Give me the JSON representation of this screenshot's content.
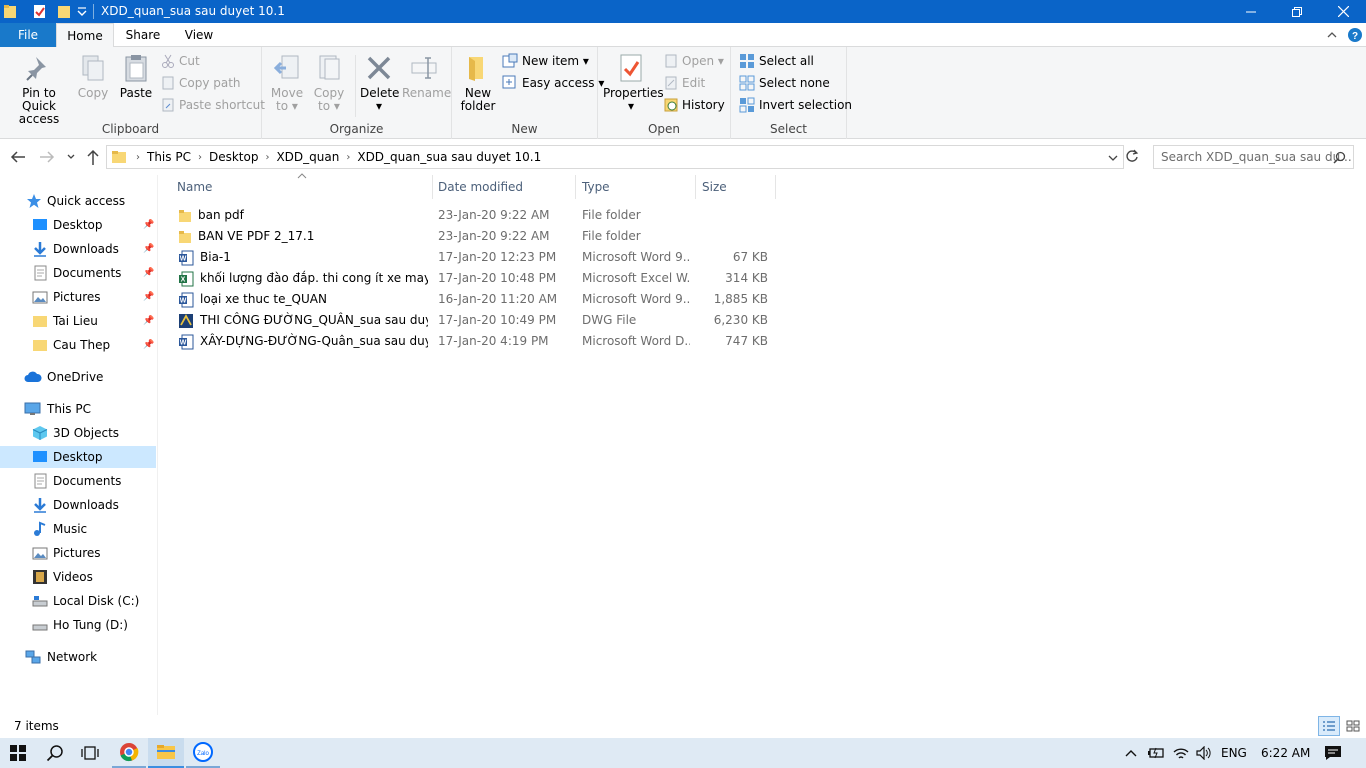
{
  "window": {
    "title": "XDD_quan_sua sau duyet 10.1"
  },
  "ribbon_tabs": {
    "file": "File",
    "home": "Home",
    "share": "Share",
    "view": "View"
  },
  "ribbon": {
    "clipboard": {
      "label": "Clipboard",
      "pin_line1": "Pin to Quick",
      "pin_line2": "access",
      "copy": "Copy",
      "paste": "Paste",
      "cut": "Cut",
      "copy_path": "Copy path",
      "paste_shortcut": "Paste shortcut"
    },
    "organize": {
      "label": "Organize",
      "move_line1": "Move",
      "move_line2": "to",
      "copy_line1": "Copy",
      "copy_line2": "to",
      "delete": "Delete",
      "rename": "Rename"
    },
    "new": {
      "label": "New",
      "new_folder_line1": "New",
      "new_folder_line2": "folder",
      "new_item": "New item",
      "easy_access": "Easy access"
    },
    "open": {
      "label": "Open",
      "properties": "Properties",
      "open": "Open",
      "edit": "Edit",
      "history": "History"
    },
    "select": {
      "label": "Select",
      "select_all": "Select all",
      "select_none": "Select none",
      "invert_selection": "Invert selection"
    }
  },
  "address": {
    "crumbs": [
      "This PC",
      "Desktop",
      "XDD_quan",
      "XDD_quan_sua sau duyet 10.1"
    ],
    "search_placeholder": "Search XDD_quan_sua sau du..."
  },
  "nav": {
    "quick_access": "Quick access",
    "quick_items": [
      "Desktop",
      "Downloads",
      "Documents",
      "Pictures",
      "Tai Lieu",
      "Cau Thep"
    ],
    "onedrive": "OneDrive",
    "this_pc": "This PC",
    "pc_items": [
      "3D Objects",
      "Desktop",
      "Documents",
      "Downloads",
      "Music",
      "Pictures",
      "Videos",
      "Local Disk (C:)",
      "Ho Tung (D:)"
    ],
    "network": "Network"
  },
  "columns": {
    "name": "Name",
    "date": "Date modified",
    "type": "Type",
    "size": "Size"
  },
  "files": [
    {
      "name": "ban pdf",
      "date": "23-Jan-20 9:22 AM",
      "type": "File folder",
      "size": "",
      "icon": "folder-icon"
    },
    {
      "name": "BAN VE PDF 2_17.1",
      "date": "23-Jan-20 9:22 AM",
      "type": "File folder",
      "size": "",
      "icon": "folder-icon"
    },
    {
      "name": "Bia-1",
      "date": "17-Jan-20 12:23 PM",
      "type": "Microsoft Word 9...",
      "size": "67 KB",
      "icon": "word-icon"
    },
    {
      "name": "khối lượng đào đắp. thi cong ít xe may lạ...",
      "date": "17-Jan-20 10:48 PM",
      "type": "Microsoft Excel W...",
      "size": "314 KB",
      "icon": "excel-icon"
    },
    {
      "name": "loại xe thuc te_QUAN",
      "date": "16-Jan-20 11:20 AM",
      "type": "Microsoft Word 9...",
      "size": "1,885 KB",
      "icon": "word-icon"
    },
    {
      "name": "THI CÔNG ĐƯỜNG_QUÂN_sua sau duyet",
      "date": "17-Jan-20 10:49 PM",
      "type": "DWG File",
      "size": "6,230 KB",
      "icon": "dwg-icon"
    },
    {
      "name": "XÂY-DỰNG-ĐƯỜNG-Quân_sua sau duyet",
      "date": "17-Jan-20 4:19 PM",
      "type": "Microsoft Word D...",
      "size": "747 KB",
      "icon": "word-icon"
    }
  ],
  "status": {
    "item_count": "7 items"
  },
  "taskbar": {
    "language": "ENG",
    "time": "6:22 AM",
    "zalo": "Zalo"
  },
  "colors": {
    "titlebar": "#0a64c8",
    "file_tab": "#1979ca",
    "selection": "#cce8ff",
    "taskbar": "#dfeaf4"
  }
}
